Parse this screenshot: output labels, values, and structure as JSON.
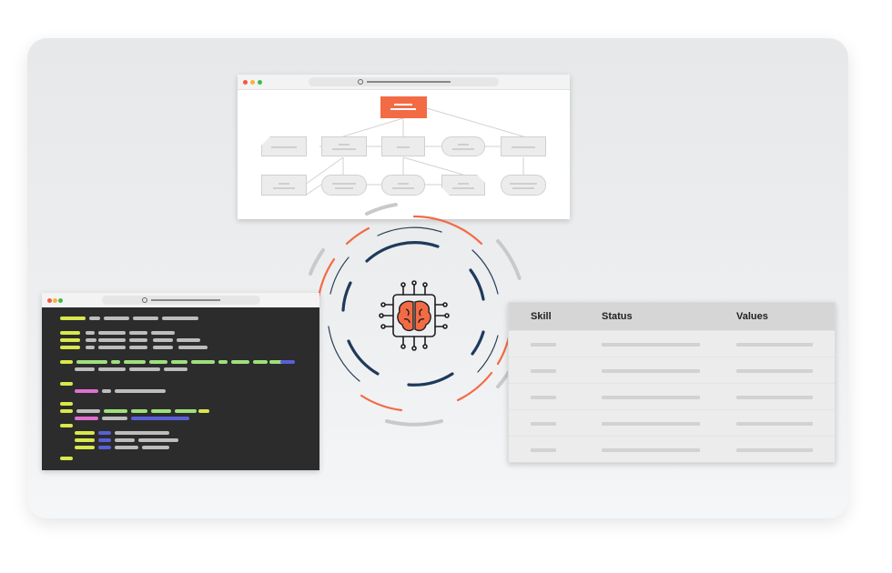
{
  "table": {
    "headers": [
      "Skill",
      "Status",
      "Values"
    ],
    "row_count": 5
  },
  "colors": {
    "accent_orange": "#f26b45",
    "ring_navy": "#1f3a5a",
    "code_yellow": "#d9e84a",
    "code_green": "#9ee07c",
    "code_purple": "#5a5fd8",
    "code_pink": "#e070d0",
    "code_gray": "#bdbdbd"
  },
  "icons": {
    "center": "ai-brain-chip-icon"
  }
}
